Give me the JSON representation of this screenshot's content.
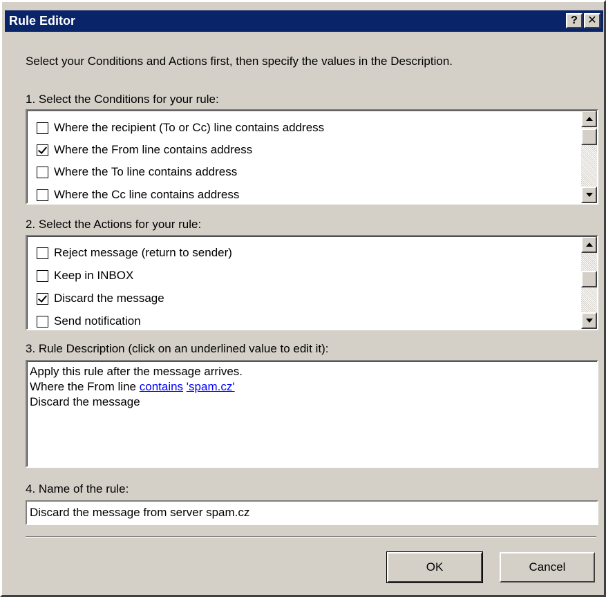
{
  "window": {
    "title": "Rule Editor",
    "help_glyph": "?",
    "close_glyph": "✕"
  },
  "intro_text": "Select your Conditions and Actions first, then specify the values in the Description.",
  "conditions": {
    "label": "1. Select the Conditions for your rule:",
    "items": [
      {
        "label": "Where the recipient (To or Cc) line contains address",
        "checked": false
      },
      {
        "label": "Where the From line contains address",
        "checked": true
      },
      {
        "label": "Where the To line contains address",
        "checked": false
      },
      {
        "label": "Where the Cc line contains address",
        "checked": false
      }
    ]
  },
  "actions": {
    "label": "2. Select the Actions for your rule:",
    "items": [
      {
        "label": "Reject message (return to sender)",
        "checked": false
      },
      {
        "label": "Keep in INBOX",
        "checked": false
      },
      {
        "label": "Discard the message",
        "checked": true
      },
      {
        "label": "Send notification",
        "checked": false
      }
    ]
  },
  "description": {
    "label": "3. Rule Description (click on an underlined value to edit it):",
    "line1": "Apply this rule after the message arrives.",
    "line2_prefix": "Where the From line ",
    "line2_link1": "contains",
    "line2_link2": "'spam.cz'",
    "line3": "Discard the message"
  },
  "rule_name": {
    "label": "4. Name of the rule:",
    "value": "Discard the message from server spam.cz"
  },
  "buttons": {
    "ok": "OK",
    "cancel": "Cancel"
  },
  "colors": {
    "titlebar": "#0a246a",
    "dialog_bg": "#d4d0c8",
    "link": "#0000ff"
  }
}
